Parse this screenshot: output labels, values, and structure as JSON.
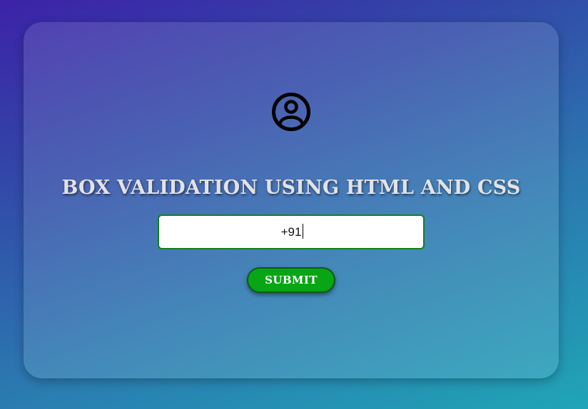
{
  "form": {
    "icon": "user-circle-icon",
    "title": "BOX VALIDATION USING HTML AND CSS",
    "phone_value": "+91",
    "submit_label": "SUBMIT"
  },
  "colors": {
    "background_gradient": [
      "#3c22a8",
      "#3249a8",
      "#2b78b0",
      "#20a5b6"
    ],
    "input_border": "#12801e",
    "button_background": "#08a614",
    "button_text": "#ffffff",
    "title_text": "#e2e2e6"
  }
}
